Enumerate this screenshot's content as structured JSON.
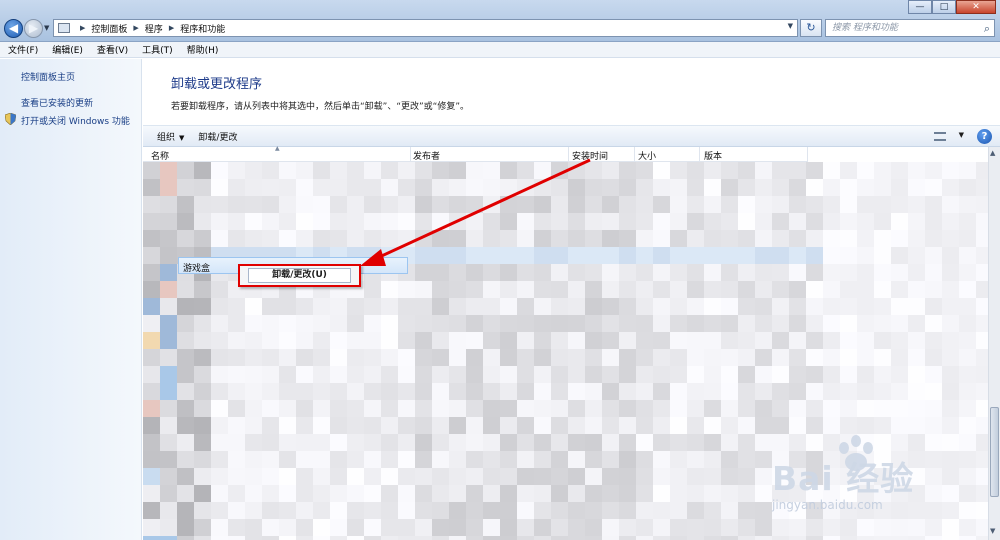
{
  "window": {
    "minimize_glyph": "—",
    "maximize_glyph": "□",
    "close_glyph": "✕"
  },
  "address": {
    "crumbs": [
      "控制面板",
      "程序",
      "程序和功能"
    ],
    "search_placeholder": "搜索 程序和功能"
  },
  "menu": [
    "文件(F)",
    "编辑(E)",
    "查看(V)",
    "工具(T)",
    "帮助(H)"
  ],
  "left_pane": {
    "links": [
      "控制面板主页",
      "查看已安装的更新",
      "打开或关闭 Windows 功能"
    ]
  },
  "main": {
    "heading": "卸载或更改程序",
    "subtext": "若要卸载程序，请从列表中将其选中，然后单击“卸载”、“更改”或“修复”。"
  },
  "toolbar": {
    "organize": "组织",
    "uninstall_change": "卸载/更改",
    "help": "?"
  },
  "columns": [
    "名称",
    "发布者",
    "安装时间",
    "大小",
    "版本"
  ],
  "selected_program": "游戏盒",
  "context_menu": {
    "item": "卸载/更改(U)"
  },
  "watermark": {
    "brand": "Bai 经验",
    "url": "jingyan.baidu.com"
  },
  "colors": {
    "highlight_border": "#e00000",
    "arrow": "#e00000",
    "link": "#1a3f86",
    "heading": "#1e3b8a"
  },
  "icons": [
    "back-arrow-icon",
    "forward-arrow-icon",
    "folder-icon",
    "refresh-icon",
    "search-icon",
    "shield-icon",
    "view-icon",
    "help-icon"
  ]
}
